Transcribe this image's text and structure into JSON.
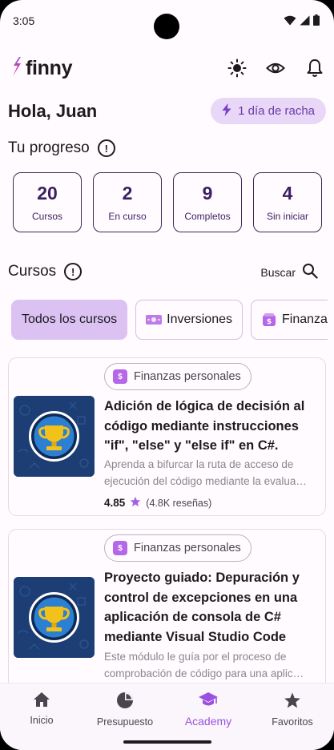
{
  "status_bar": {
    "time": "3:05",
    "icons": [
      "wifi-icon",
      "signal-icon",
      "battery-icon"
    ]
  },
  "header": {
    "logo_text": "finny",
    "icons": [
      "sun-icon",
      "eye-icon",
      "bell-icon"
    ]
  },
  "greeting": "Hola, Juan",
  "streak": {
    "label": "1 día de racha",
    "icon": "lightning-icon"
  },
  "progress": {
    "title": "Tu progreso",
    "stats": [
      {
        "value": "20",
        "label": "Cursos"
      },
      {
        "value": "2",
        "label": "En curso"
      },
      {
        "value": "9",
        "label": "Completos"
      },
      {
        "value": "4",
        "label": "Sin iniciar"
      }
    ]
  },
  "courses": {
    "title": "Cursos",
    "search_label": "Buscar",
    "chips": [
      {
        "label": "Todos los cursos",
        "active": true,
        "icon": ""
      },
      {
        "label": "Inversiones",
        "active": false,
        "icon": "money-icon"
      },
      {
        "label": "Finanzas personales",
        "active": false,
        "icon": "wallet-icon"
      }
    ],
    "items": [
      {
        "category": "Finanzas personales",
        "title_lines": [
          "Adición de lógica de decisión al",
          "código mediante instrucciones",
          "\"if\", \"else\" y \"else if\" en C#."
        ],
        "desc_lines": [
          "Aprenda a bifurcar la ruta de acceso de",
          "ejecución del código mediante la evalua…"
        ],
        "rating": "4.85",
        "reviews": "(4.8K reseñas)"
      },
      {
        "category": "Finanzas personales",
        "title_lines": [
          "Proyecto guiado: Depuración y",
          "control de excepciones en una",
          "aplicación de consola de C#",
          "mediante Visual Studio Code"
        ],
        "desc_lines": [
          "Este módulo le guía por el proceso de",
          "comprobación de código para una aplic…"
        ],
        "rating": "",
        "reviews": ""
      }
    ]
  },
  "bottom_nav": [
    {
      "label": "Inicio",
      "icon": "home-icon",
      "active": false
    },
    {
      "label": "Presupuesto",
      "icon": "pie-chart-icon",
      "active": false
    },
    {
      "label": "Academy",
      "icon": "graduation-cap-icon",
      "active": true
    },
    {
      "label": "Favoritos",
      "icon": "star-icon",
      "active": false
    }
  ],
  "colors": {
    "accent": "#9b51e0",
    "chip_active": "#dbc2f3",
    "streak_bg": "#e8d7f7",
    "thumb_bg": "#1d3e74"
  }
}
